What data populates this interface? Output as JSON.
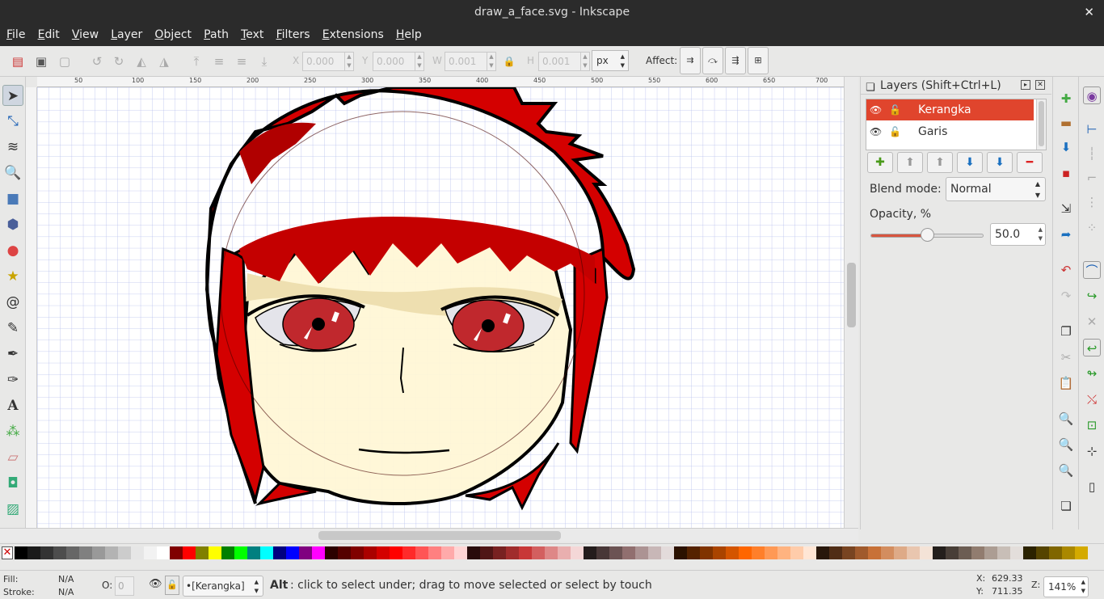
{
  "window": {
    "title": "draw_a_face.svg - Inkscape",
    "close": "✕"
  },
  "menu": [
    "File",
    "Edit",
    "View",
    "Layer",
    "Object",
    "Path",
    "Text",
    "Filters",
    "Extensions",
    "Help"
  ],
  "controls": {
    "x_label": "X",
    "x_value": "0.000",
    "y_label": "Y",
    "y_value": "0.000",
    "w_label": "W",
    "w_value": "0.001",
    "h_label": "H",
    "h_value": "0.001",
    "unit": "px",
    "affect_label": "Affect:"
  },
  "ruler": {
    "h_ticks": [
      "50",
      "100",
      "150",
      "200",
      "250",
      "300",
      "350",
      "400",
      "450",
      "500",
      "550",
      "600",
      "650",
      "700"
    ]
  },
  "layers_panel": {
    "title": "Layers (Shift+Ctrl+L)",
    "layers": [
      {
        "name": "Kerangka",
        "selected": true
      },
      {
        "name": "Garis",
        "selected": false
      }
    ],
    "blend_label": "Blend mode:",
    "blend_value": "Normal",
    "opacity_label": "Opacity, %",
    "opacity_value": "50.0",
    "opacity_fraction": 0.5
  },
  "palette": [
    "#000000",
    "#1a1a1a",
    "#333333",
    "#4d4d4d",
    "#666666",
    "#808080",
    "#999999",
    "#b3b3b3",
    "#cccccc",
    "#e6e6e6",
    "#f2f2f2",
    "#ffffff",
    "#800000",
    "#ff0000",
    "#808000",
    "#ffff00",
    "#008000",
    "#00ff00",
    "#008080",
    "#00ffff",
    "#000080",
    "#0000ff",
    "#800080",
    "#ff00ff",
    "#2b0000",
    "#550000",
    "#800000",
    "#aa0000",
    "#d40000",
    "#ff0000",
    "#ff2a2a",
    "#ff5555",
    "#ff8080",
    "#ffaaaa",
    "#ffd5d5",
    "#280b0b",
    "#501616",
    "#782121",
    "#a02c2c",
    "#c83737",
    "#d35f5f",
    "#de8787",
    "#e9afaf",
    "#f4d7d7",
    "#241c1c",
    "#483737",
    "#6c5353",
    "#916f6f",
    "#ac9393",
    "#c8b7b7",
    "#e3dbdb",
    "#2b1100",
    "#552200",
    "#803300",
    "#aa4400",
    "#d45500",
    "#ff6600",
    "#ff7f2a",
    "#ff9955",
    "#ffb380",
    "#ffccaa",
    "#ffe6d5",
    "#28170b",
    "#502d16",
    "#784421",
    "#a05a2c",
    "#c87137",
    "#d38d5f",
    "#deaa87",
    "#e9c6af",
    "#f4e3d7",
    "#241f1c",
    "#483e37",
    "#6c5d53",
    "#917c6f",
    "#ac9d93",
    "#c8beb7",
    "#e3dedb",
    "#2b2200",
    "#554400",
    "#806600",
    "#aa8800",
    "#d4aa00"
  ],
  "status": {
    "fill_label": "Fill:",
    "fill_value": "N/A",
    "stroke_label": "Stroke:",
    "stroke_value": "N/A",
    "o_label": "O:",
    "o_value": "0",
    "layer_combo": "•[Kerangka]",
    "message_bold": "Alt",
    "message": ": click to select under; drag to move selected or select by touch",
    "x_label": "X:",
    "x_value": "629.33",
    "y_label": "Y:",
    "y_value": "711.35",
    "z_label": "Z:",
    "zoom": "141%"
  },
  "colors": {
    "hair": "#d40000",
    "hair_dark": "#b00000",
    "skin": "#fff6d5",
    "iris": "#c0282d",
    "layer_selected": "#e0452d"
  }
}
